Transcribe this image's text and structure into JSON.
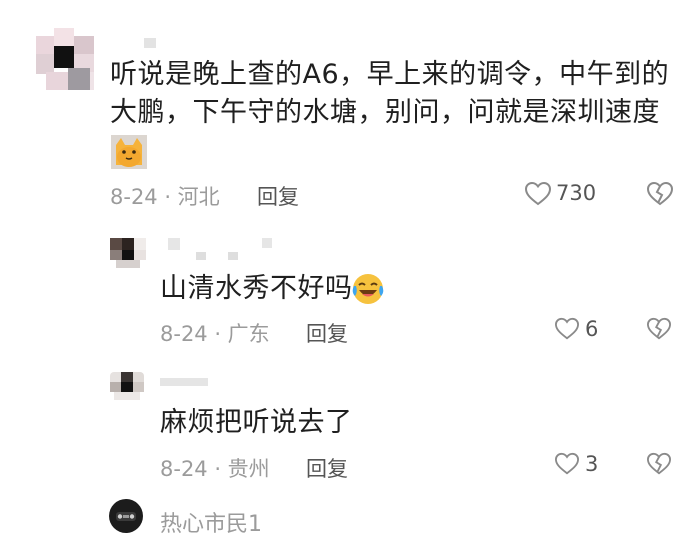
{
  "comments": [
    {
      "text_line1": "听说是晚上查的A6，早上来的调令，中午到的",
      "text_line2": "大鹏，下午守的水塘，别问，问就是深圳速度",
      "meta": "8-24 · 河北",
      "reply_label": "回复",
      "likes": "730"
    },
    {
      "text": "山清水秀不好吗",
      "meta": "8-24 · 广东",
      "reply_label": "回复",
      "likes": "6"
    },
    {
      "text": "麻烦把听说去了",
      "meta": "8-24 · 贵州",
      "reply_label": "回复",
      "likes": "3"
    }
  ],
  "next_user": {
    "name": "热心市民1"
  },
  "icons": {
    "like": "heart-outline-icon",
    "dislike": "broken-heart-icon",
    "emoji1": "cat-emoji-icon",
    "emoji2": "laughing-crying-emoji-icon"
  },
  "colors": {
    "meta_text": "#9b9b9b",
    "body_text": "#1f1f1f",
    "emoji_yellow": "#f6c23e"
  }
}
